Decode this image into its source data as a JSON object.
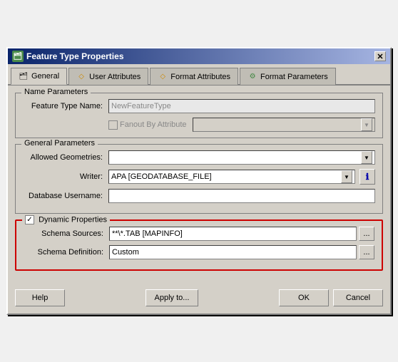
{
  "window": {
    "title": "Feature Type Properties",
    "title_icon": "🗂"
  },
  "tabs": [
    {
      "label": "General",
      "icon": "🗂",
      "active": true
    },
    {
      "label": "User Attributes",
      "icon": "◇",
      "active": false
    },
    {
      "label": "Format Attributes",
      "icon": "◇",
      "active": false
    },
    {
      "label": "Format Parameters",
      "icon": "⚙",
      "active": false
    }
  ],
  "name_parameters": {
    "group_label": "Name Parameters",
    "feature_type_label": "Feature Type Name:",
    "feature_type_value": "NewFeatureType",
    "fanout_label": "Fanout By Attribute",
    "fanout_dropdown": ""
  },
  "general_parameters": {
    "group_label": "General Parameters",
    "geometries_label": "Allowed Geometries:",
    "writer_label": "Writer:",
    "writer_value": "APA [GEODATABASE_FILE]",
    "db_username_label": "Database Username:"
  },
  "dynamic_properties": {
    "group_label": "Dynamic Properties",
    "checkbox_label": "Dynamic Properties",
    "schema_sources_label": "Schema Sources:",
    "schema_sources_value": "**\\*.TAB [MAPINFO]",
    "schema_definition_label": "Schema Definition:",
    "schema_definition_value": "Custom",
    "browse_btn": "...",
    "info_icon": "ℹ"
  },
  "buttons": {
    "help": "Help",
    "apply_to": "Apply to...",
    "ok": "OK",
    "cancel": "Cancel"
  }
}
